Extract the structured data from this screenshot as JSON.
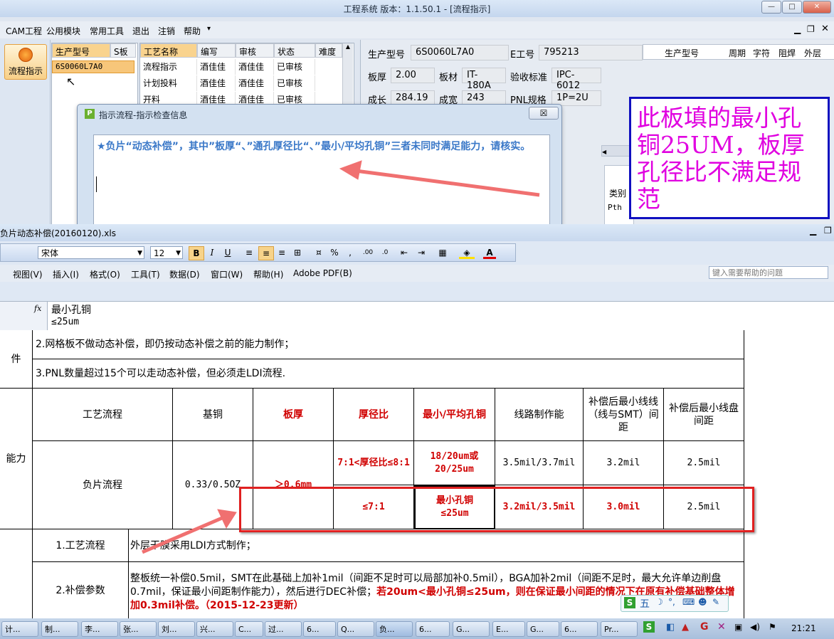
{
  "app": {
    "title": "工程系统  版本：1.1.50.1 - [流程指示]",
    "menu": [
      "CAM工程",
      "公用模块",
      "常用工具",
      "退出",
      "注销",
      "帮助"
    ],
    "dropdown_arrow": "▾",
    "sidebar_button": "流程指示"
  },
  "model_list": {
    "headers": [
      "生产型号",
      "S板"
    ],
    "items": [
      "6S0060L7A0"
    ]
  },
  "process_grid": {
    "headers": [
      "工艺名称",
      "编写",
      "审核",
      "状态",
      "难度"
    ],
    "rows": [
      [
        "流程指示",
        "酒佳佳",
        "酒佳佳",
        "已审核"
      ],
      [
        "计划投料",
        "酒佳佳",
        "酒佳佳",
        "已审核"
      ],
      [
        "开料",
        "酒佳佳",
        "酒佳佳",
        "已审核"
      ]
    ]
  },
  "info_panel": {
    "model_label": "生产型号",
    "model_value": "6S0060L7A0",
    "e_label": "E工号",
    "e_value": "795213",
    "thickness_label": "板厚",
    "thickness_value": "2.00",
    "material_label": "板材",
    "material_value": "IT-180A",
    "standard_label": "验收标准",
    "standard_value": "IPC-6012",
    "length_label": "成长",
    "length_value": "284.19",
    "width_label": "成宽",
    "width_value": "243",
    "pnl_label": "PNL规格",
    "pnl_value": "1P=2U",
    "grid2_headers": [
      "生产型号",
      "周期",
      "字符",
      "阻焊",
      "外层"
    ],
    "category_label": "类别",
    "pth_label": "Pth"
  },
  "dialog": {
    "title": "指示流程-指示检查信息",
    "message": "★负片“动态补偿”，其中”板厚“、”通孔厚径比“、”最小/平均孔铜”三者未同时满足能力，请核实。",
    "close": "☒"
  },
  "annotation": {
    "text": "此板填的最小孔铜25UM，板厚孔径比不满足规范"
  },
  "excel": {
    "title": "负片动态补偿(20160120).xls",
    "font_name": "宋体",
    "font_size": "12",
    "menu": [
      "视图(V)",
      "插入(I)",
      "格式(O)",
      "工具(T)",
      "数据(D)",
      "窗口(W)",
      "帮助(H)",
      "Adobe PDF(B)"
    ],
    "help_placeholder": "键入需要帮助的问题",
    "fx_label": "fx",
    "fx_line1": "最小孔铜",
    "fx_line2": "≤25um",
    "row_label_1": "件",
    "note_2": "2.网格板不做动态补偿，即仍按动态补偿之前的能力制作；",
    "note_3": "3.PNL数量超过15个可以走动态补偿，但必须走LDI流程.",
    "row_label_2": "能力",
    "table": {
      "headers": [
        "工艺流程",
        "基铜",
        "板厚",
        "厚径比",
        "最小/平均孔铜",
        "线路制作能",
        "补偿后最小线线（线与SMT）间距",
        "补偿后最小线盘间距"
      ],
      "process_name": "负片流程",
      "base_copper": "0.33/0.5OZ",
      "thickness": "＞0.6mm",
      "row1": [
        "7:1<厚径比≤8:1",
        "18/20um或20/25um",
        "3.5mil/3.7mil",
        "3.2mil",
        "2.5mil"
      ],
      "row2": [
        "≤7:1",
        "最小孔铜≤25um",
        "3.2mil/3.5mil",
        "3.0mil",
        "2.5mil"
      ]
    },
    "section1_label": "1.工艺流程",
    "section1_text": "外层干膜采用LDI方式制作；",
    "section2_label": "2.补偿参数",
    "section2_text_a": "整板统一补偿0.5mil，SMT在此基础上加补1mil（间距不足时可以局部加补0.5mil），BGA加补2mil（间距不足时，最大允许单边削盘0.7mil，保证最小间距制作能力），然后进行DEC补偿；",
    "section2_text_b": "若20um<最小孔铜≤25um，则在保证最小间距的情况下在原有补偿基础整体增加0.3mil补偿。（2015-12-23更新）"
  },
  "taskbar": {
    "items": [
      "计...",
      "制...",
      "李...",
      "张...",
      "刘...",
      "兴...",
      "C...",
      "过...",
      "6...",
      "Q...",
      "负...",
      "6...",
      "G...",
      "E...",
      "G...",
      "6...",
      "Pr..."
    ],
    "clock": "21:21"
  },
  "colors": {
    "annotation_text": "#e000e0",
    "annotation_border": "#1010c0",
    "highlight_box": "#e02020",
    "arrow": "#f07070",
    "red_text": "#d00000"
  }
}
